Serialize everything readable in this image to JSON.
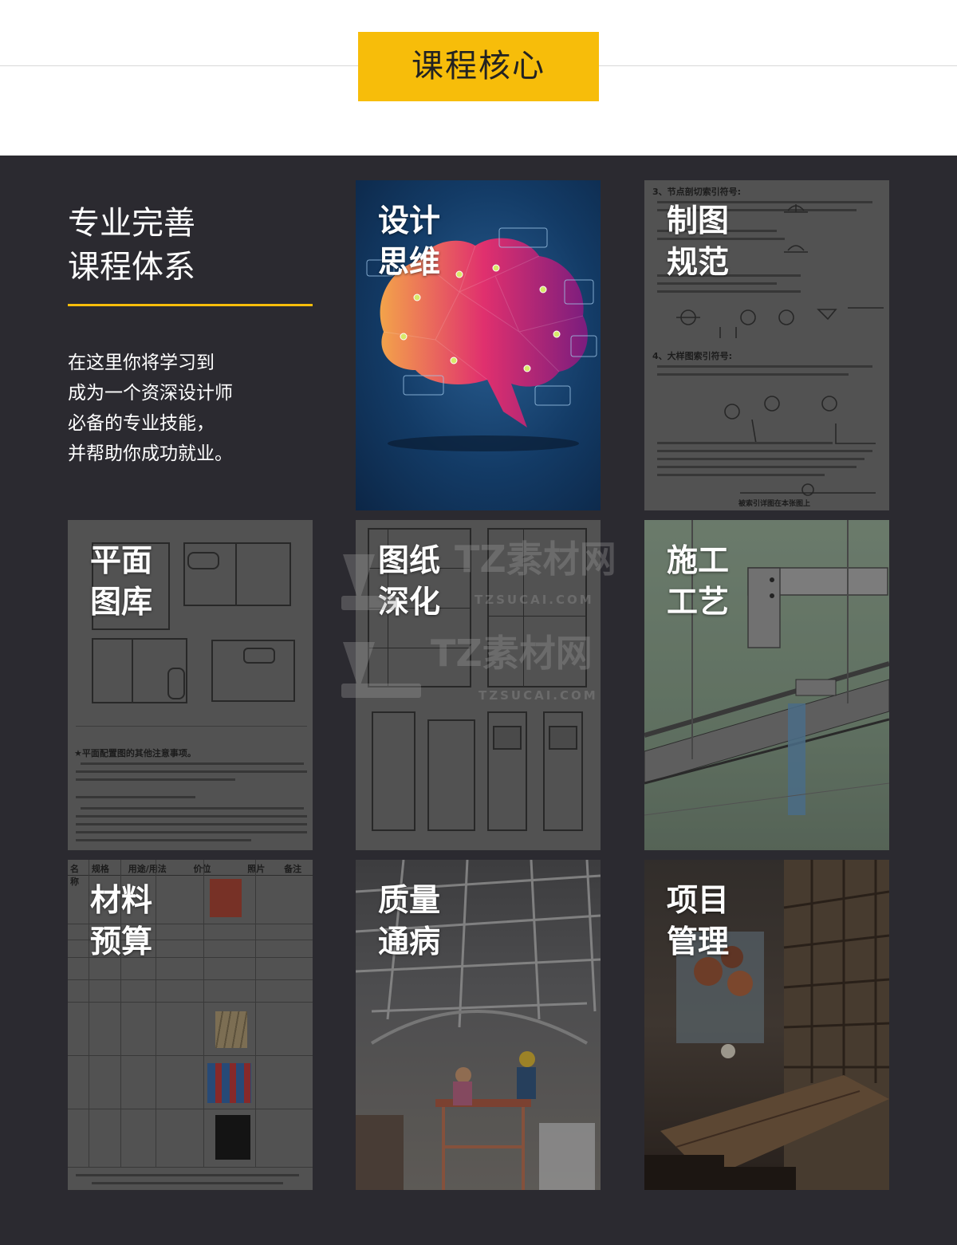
{
  "header": {
    "badge": "课程核心"
  },
  "intro": {
    "heading": "专业完善\n课程体系",
    "description": "在这里你将学习到\n成为一个资深设计师\n必备的专业技能，\n并帮助你成功就业。"
  },
  "cards": [
    {
      "title": "设计\n思维",
      "icon": "brain-illustration"
    },
    {
      "title": "制图\n规范",
      "icon": "drawing-standard-sheet"
    },
    {
      "title": "平面\n图库",
      "icon": "floor-plan-sheet"
    },
    {
      "title": "图纸\n深化",
      "icon": "detail-drawing-sheet"
    },
    {
      "title": "施工\n工艺",
      "icon": "ceiling-construction-render"
    },
    {
      "title": "材料\n预算",
      "icon": "material-table-sheet"
    },
    {
      "title": "质量\n通病",
      "icon": "construction-site-photo"
    },
    {
      "title": "项目\n管理",
      "icon": "restaurant-interior-photo"
    }
  ],
  "sheet_labels": {
    "drawing_heading_1": "3、节点剖切索引符号:",
    "drawing_heading_2": "4、大样图索引符号:",
    "drawing_footer": "被索引详图在本张图上",
    "plan_notes_title": "★平面配置图的其他注意事项。",
    "table_headers": [
      "名称",
      "规格",
      "用途/用法",
      "价位",
      "照片",
      "备注"
    ]
  },
  "colors": {
    "accent": "#f7bd0a",
    "panel": "#2b2a30"
  },
  "watermark": {
    "brand": "TZ素材网",
    "domain": "TZSUCAI.COM"
  }
}
